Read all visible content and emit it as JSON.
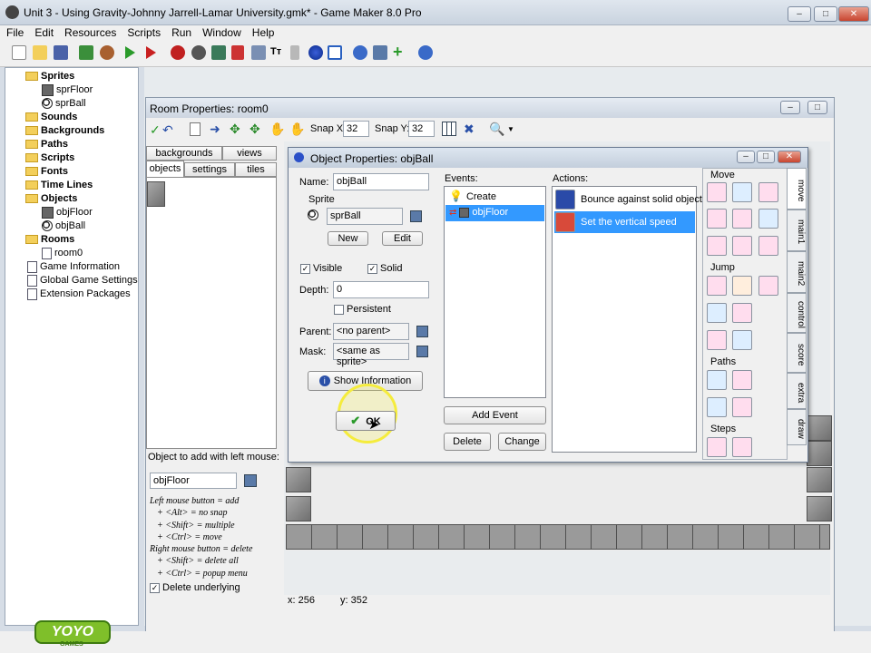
{
  "app": {
    "title": "Unit 3 - Using Gravity-Johnny Jarrell-Lamar University.gmk* - Game Maker 8.0 Pro"
  },
  "menu": [
    "File",
    "Edit",
    "Resources",
    "Scripts",
    "Run",
    "Window",
    "Help"
  ],
  "tree": {
    "sprites": "Sprites",
    "spr_floor": "sprFloor",
    "spr_ball": "sprBall",
    "sounds": "Sounds",
    "backgrounds": "Backgrounds",
    "paths": "Paths",
    "scripts": "Scripts",
    "fonts": "Fonts",
    "timelines": "Time Lines",
    "objects": "Objects",
    "obj_floor": "objFloor",
    "obj_ball": "objBall",
    "rooms": "Rooms",
    "room0": "room0",
    "game_info": "Game Information",
    "global_settings": "Global Game Settings",
    "ext_packages": "Extension Packages"
  },
  "room": {
    "title": "Room Properties: room0",
    "snap_x_label": "Snap X:",
    "snap_x": "32",
    "snap_y_label": "Snap Y:",
    "snap_y": "32",
    "tabs": {
      "backgrounds": "backgrounds",
      "views": "views",
      "objects": "objects",
      "settings": "settings",
      "tiles": "tiles"
    },
    "add_object_label": "Object to add with left mouse:",
    "add_object_value": "objFloor",
    "help_lines": [
      "Left mouse button = add",
      "+ <Alt> = no snap",
      "+ <Shift> = multiple",
      "+ <Ctrl> = move",
      "Right mouse button = delete",
      "+ <Shift> = delete all",
      "+ <Ctrl> = popup menu"
    ],
    "delete_underlying": "Delete underlying",
    "coord_x": "x: 256",
    "coord_y": "y: 352"
  },
  "obj": {
    "title": "Object Properties: objBall",
    "name_label": "Name:",
    "name_value": "objBall",
    "sprite_label": "Sprite",
    "sprite_value": "sprBall",
    "new_btn": "New",
    "edit_btn": "Edit",
    "visible": "Visible",
    "solid": "Solid",
    "depth_label": "Depth:",
    "depth_value": "0",
    "persistent": "Persistent",
    "parent_label": "Parent:",
    "parent_value": "<no parent>",
    "mask_label": "Mask:",
    "mask_value": "<same as sprite>",
    "show_info": "Show Information",
    "ok": "OK",
    "events_label": "Events:",
    "events": [
      "Create",
      "objFloor"
    ],
    "add_event": "Add Event",
    "delete_btn": "Delete",
    "change_btn": "Change",
    "actions_label": "Actions:",
    "actions": [
      "Bounce against solid objects",
      "Set the vertical speed"
    ],
    "lib_move": "Move",
    "lib_jump": "Jump",
    "lib_paths": "Paths",
    "lib_steps": "Steps",
    "tabs": [
      "move",
      "main1",
      "main2",
      "control",
      "score",
      "extra",
      "draw"
    ]
  },
  "logo": {
    "text": "YOYO",
    "sub": "GAMES"
  },
  "colors": {
    "selection": "#3399ff",
    "title_bg": "#d6dde6"
  }
}
